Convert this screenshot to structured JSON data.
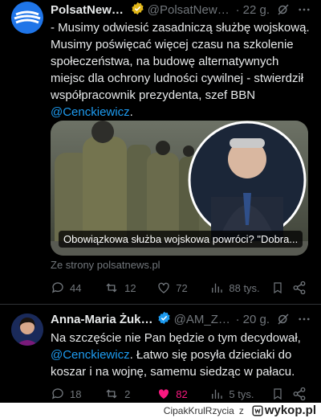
{
  "tweets": [
    {
      "name": "PolsatNews...",
      "handle": "@PolsatNews...",
      "time": "22 g.",
      "text_lines": [
        "- Musimy odwiesić zasadniczą służbę wojskową.",
        "Musimy poświęcać więcej czasu na szkolenie",
        "społeczeństwa, na budowę alternatywnych",
        "miejsc dla ochrony ludności cywilnej - stwierdził",
        "współpracownik prezydenta, szef BBN"
      ],
      "mention": "@Cenckiewicz",
      "after_mention": ".",
      "card_caption": "Obowiązkowa służba wojskowa powróci? \"Dobra...",
      "source": "Ze strony polsatnews.pl",
      "stats": {
        "replies": "44",
        "retweets": "12",
        "likes": "72",
        "views": "88 tys."
      }
    },
    {
      "name": "Anna-Maria Żuko...",
      "handle": "@AM_Zu...",
      "time": "20 g.",
      "line1": "Na szczęście nie Pan będzie o tym decydował,",
      "mention": "@Cenckiewicz",
      "line2_rest": ". Łatwo się posyła dzieciaki do",
      "line3": "koszar i na wojnę, samemu siedząc w pałacu.",
      "stats": {
        "replies": "18",
        "retweets": "2",
        "likes": "82",
        "views": "5 tys."
      }
    }
  ],
  "watermark": {
    "user": "CipakKrulRzycia",
    "z": "z",
    "site": "wykop.pl"
  },
  "colors": {
    "accent": "#1d9bf0",
    "muted": "#71767b",
    "like": "#f91880"
  },
  "icons": [
    "verified-badge-icon",
    "grok-icon",
    "more-icon",
    "reply-icon",
    "retweet-icon",
    "like-icon",
    "views-icon",
    "bookmark-icon",
    "share-icon"
  ]
}
